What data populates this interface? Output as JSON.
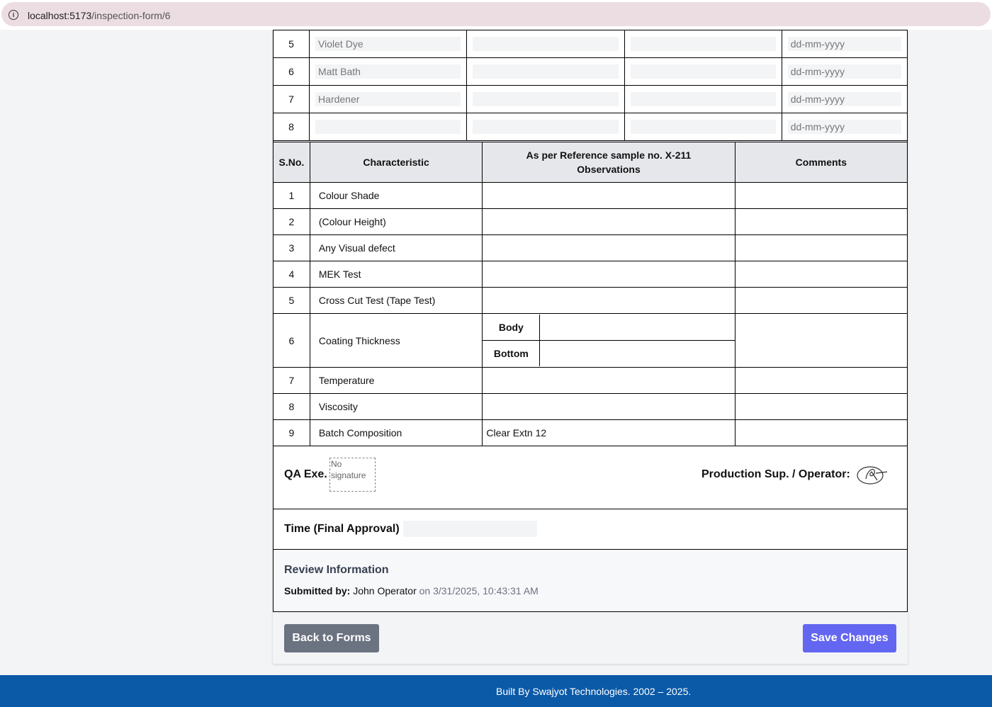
{
  "browser": {
    "url_host": "localhost:5173",
    "url_path": "/inspection-form/6"
  },
  "chemicals": [
    {
      "sno": "5",
      "name": "Violet Dye",
      "date_placeholder": "dd-mm-yyyy"
    },
    {
      "sno": "6",
      "name": "Matt Bath",
      "date_placeholder": "dd-mm-yyyy"
    },
    {
      "sno": "7",
      "name": "Hardener",
      "date_placeholder": "dd-mm-yyyy"
    },
    {
      "sno": "8",
      "name": "",
      "date_placeholder": "dd-mm-yyyy"
    }
  ],
  "inspection": {
    "headers": {
      "sno": "S.No.",
      "characteristic": "Characteristic",
      "observations_line1": "As per Reference sample no. X-211",
      "observations_line2": "Observations",
      "comments": "Comments"
    },
    "rows": [
      {
        "sno": "1",
        "characteristic": "Colour Shade",
        "observation": ""
      },
      {
        "sno": "2",
        "characteristic": "(Colour Height)",
        "observation": ""
      },
      {
        "sno": "3",
        "characteristic": "Any Visual defect",
        "observation": ""
      },
      {
        "sno": "4",
        "characteristic": "MEK Test",
        "observation": ""
      },
      {
        "sno": "5",
        "characteristic": "Cross Cut Test (Tape Test)",
        "observation": ""
      },
      {
        "sno": "6",
        "characteristic": "Coating Thickness",
        "sub_body": "Body",
        "sub_bottom": "Bottom"
      },
      {
        "sno": "7",
        "characteristic": "Temperature",
        "observation": ""
      },
      {
        "sno": "8",
        "characteristic": "Viscosity",
        "observation": ""
      },
      {
        "sno": "9",
        "characteristic": "Batch Composition",
        "observation": "Clear Extn 12"
      }
    ]
  },
  "signatures": {
    "qa_label": "QA Exe.",
    "qa_no_signature_line1": "No",
    "qa_no_signature_line2": "signature",
    "production_label": "Production Sup. / Operator:"
  },
  "final_approval": {
    "label": "Time (Final Approval) :"
  },
  "review": {
    "title": "Review Information",
    "submitted_by_label": "Submitted by:",
    "submitted_by": "John Operator",
    "submitted_on": "on 3/31/2025, 10:43:31 AM"
  },
  "actions": {
    "back_label": "Back to Forms",
    "save_label": "Save Changes"
  },
  "footer": {
    "text": "Built By Swajyot Technologies. 2002 – 2025."
  },
  "colors": {
    "primary": "#6366f1",
    "secondary": "#6b7280",
    "footer": "#0b5aa8"
  }
}
